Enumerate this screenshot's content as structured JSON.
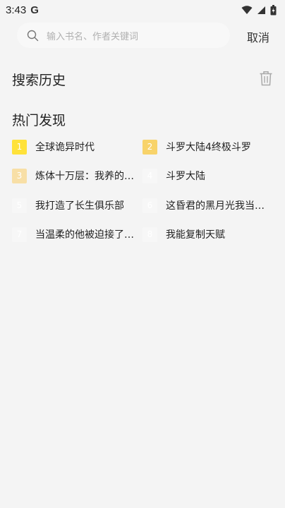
{
  "status": {
    "time": "3:43",
    "g_label": "G"
  },
  "search": {
    "placeholder": "输入书名、作者关键词",
    "cancel_label": "取消"
  },
  "history": {
    "title": "搜索历史"
  },
  "hot": {
    "title": "热门发现",
    "items": [
      {
        "rank": "1",
        "text": "全球诡异时代",
        "badge_color": "#ffe23a"
      },
      {
        "rank": "2",
        "text": "斗罗大陆4终极斗罗",
        "badge_color": "#f8d36a"
      },
      {
        "rank": "3",
        "text": "炼体十万层：我养的…",
        "badge_color": "#f8dfa6"
      },
      {
        "rank": "4",
        "text": "斗罗大陆",
        "badge_color": "#f7f7f7"
      },
      {
        "rank": "5",
        "text": "我打造了长生俱乐部",
        "badge_color": "#f7f7f7"
      },
      {
        "rank": "6",
        "text": "这昏君的黑月光我当…",
        "badge_color": "#f7f7f7"
      },
      {
        "rank": "7",
        "text": "当温柔的他被迫接了…",
        "badge_color": "#f7f7f7"
      },
      {
        "rank": "8",
        "text": "我能复制天赋",
        "badge_color": "#f7f7f7"
      }
    ]
  }
}
